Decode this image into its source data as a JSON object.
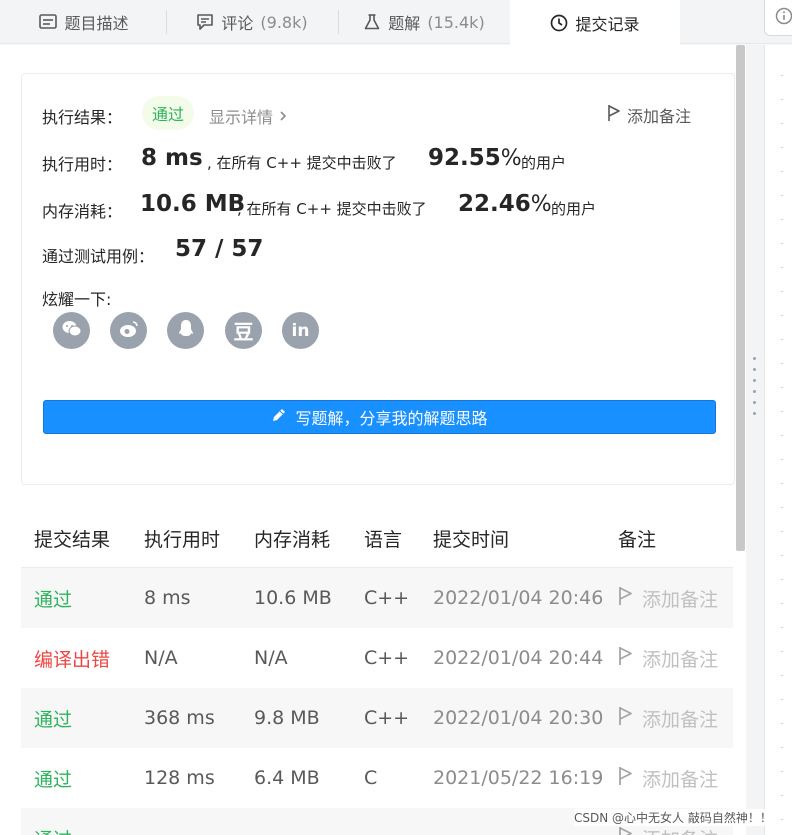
{
  "tabs": [
    {
      "label": "题目描述",
      "count": "",
      "icon": "description-icon"
    },
    {
      "label": "评论",
      "count": "(9.8k)",
      "icon": "comment-icon"
    },
    {
      "label": "题解",
      "count": "(15.4k)",
      "icon": "flask-icon"
    },
    {
      "label": "提交记录",
      "count": "",
      "icon": "clock-icon",
      "active": true
    }
  ],
  "result": {
    "label_result": "执行结果：",
    "status": "通过",
    "show_details": "显示详情",
    "add_note": "添加备注",
    "label_time": "执行用时：",
    "time_value": "8 ms",
    "time_text": ", 在所有 C++ 提交中击败了",
    "time_pct": "92.55",
    "pct_sign": "%",
    "users_text": "的用户",
    "label_memory": "内存消耗：",
    "memory_value": "10.6 MB",
    "memory_text": ", 在所有 C++ 提交中击败了",
    "memory_pct": "22.46",
    "label_tests": "通过测试用例：",
    "tests_value": "57 / 57",
    "label_share": "炫耀一下:",
    "share_icons": [
      "wechat-icon",
      "weibo-icon",
      "qq-icon",
      "douban-icon",
      "linkedin-icon"
    ],
    "douban_glyph": "豆",
    "linkedin_glyph": "in",
    "write_button": "写题解，分享我的解题思路"
  },
  "table": {
    "headers": [
      "提交结果",
      "执行用时",
      "内存消耗",
      "语言",
      "提交时间",
      "备注"
    ],
    "rows": [
      {
        "status": "通过",
        "status_type": "ok",
        "runtime": "8 ms",
        "memory": "10.6 MB",
        "lang": "C++",
        "time": "2022/01/04 20:46",
        "note": "添加备注"
      },
      {
        "status": "编译出错",
        "status_type": "err",
        "runtime": "N/A",
        "memory": "N/A",
        "lang": "C++",
        "time": "2022/01/04 20:44",
        "note": "添加备注"
      },
      {
        "status": "通过",
        "status_type": "ok",
        "runtime": "368 ms",
        "memory": "9.8 MB",
        "lang": "C++",
        "time": "2022/01/04 20:30",
        "note": "添加备注"
      },
      {
        "status": "通过",
        "status_type": "ok",
        "runtime": "128 ms",
        "memory": "6.4 MB",
        "lang": "C",
        "time": "2021/05/22 16:19",
        "note": "添加备注"
      },
      {
        "status": "通过",
        "status_type": "ok",
        "runtime": "",
        "memory": "",
        "lang": "",
        "time": "",
        "note": "添加备注"
      }
    ]
  },
  "watermark": "CSDN @心中无女人 敲码自然神！！",
  "colors": {
    "accent": "#1890ff",
    "success": "#2db55d",
    "error": "#ef4743"
  }
}
